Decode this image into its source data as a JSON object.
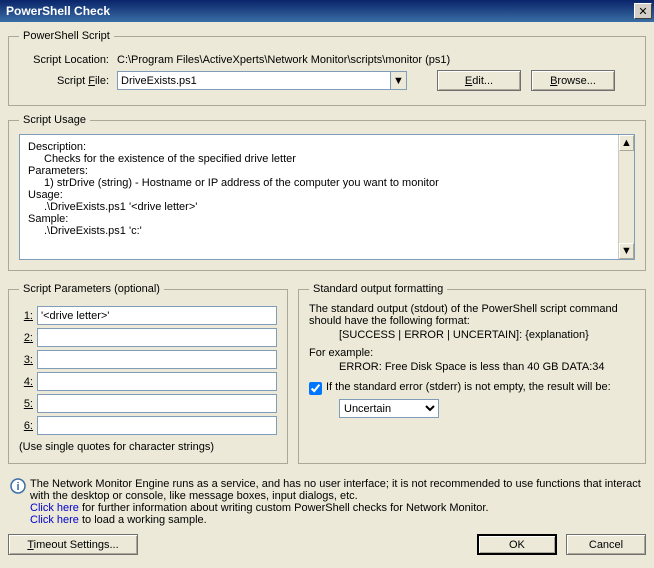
{
  "window": {
    "title": "PowerShell Check"
  },
  "script_group": {
    "legend": "PowerShell Script",
    "location_label": "Script Location:",
    "location_value": "C:\\Program Files\\ActiveXperts\\Network Monitor\\scripts\\monitor (ps1)",
    "file_label": "Script File:",
    "file_value": "DriveExists.ps1",
    "edit_label": "Edit...",
    "browse_label": "Browse..."
  },
  "usage_group": {
    "legend": "Script Usage",
    "description_label": "Description:",
    "description": "Checks for the existence of the specified drive letter",
    "parameters_label": "Parameters:",
    "parameters": "1) strDrive (string)  - Hostname or IP address of the computer you want to monitor",
    "usage_label": "Usage:",
    "usage": ".\\DriveExists.ps1 '<drive letter>'",
    "sample_label": "Sample:",
    "sample": ".\\DriveExists.ps1 'c:'"
  },
  "params_group": {
    "legend": "Script Parameters (optional)",
    "labels": {
      "p1": "1:",
      "p2": "2:",
      "p3": "3:",
      "p4": "4:",
      "p5": "5:",
      "p6": "6:"
    },
    "values": {
      "p1": "'<drive letter>'",
      "p2": "",
      "p3": "",
      "p4": "",
      "p5": "",
      "p6": ""
    },
    "hint": "(Use single quotes for character strings)"
  },
  "stdout_group": {
    "legend": "Standard output formatting",
    "line1": "The standard output (stdout) of the PowerShell script command should have the following format:",
    "format": "[SUCCESS | ERROR | UNCERTAIN]: {explanation}",
    "example_label": "For example:",
    "example": "ERROR: Free Disk Space is less than 40 GB DATA:34",
    "checkbox_label": "If the standard error (stderr) is not empty, the result will be:",
    "select_value": "Uncertain"
  },
  "info": {
    "text1": "The Network Monitor Engine runs as a service, and has no user interface; it is not recommended to use functions that interact with the desktop or console, like message boxes, input dialogs, etc.",
    "link1": "Click here",
    "text2": " for further information about writing custom PowerShell checks for Network Monitor.",
    "link2": "Click here",
    "text3": " to load a working sample."
  },
  "buttons": {
    "timeout": "Timeout Settings...",
    "ok": "OK",
    "cancel": "Cancel"
  }
}
